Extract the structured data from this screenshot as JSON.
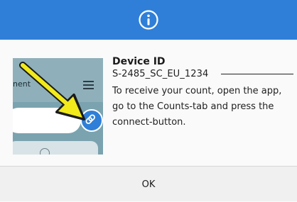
{
  "dialog": {
    "header_icon": "info-icon",
    "title": "Device ID",
    "device_id": "S-2485_SC_EU_1234",
    "description": "To receive your count, open the app, go to the Counts-tab and press the connect-button.",
    "ok_label": "OK"
  },
  "preview": {
    "fragment_text": "nent",
    "icons": [
      "hamburger-icon",
      "link-icon",
      "check-circle-icon",
      "arrow-icon"
    ]
  },
  "colors": {
    "header_blue": "#2f7fd8",
    "arrow_yellow": "#f2ea1b",
    "preview_teal": "#7aa3af",
    "footer_gray": "#f0f0f0"
  }
}
